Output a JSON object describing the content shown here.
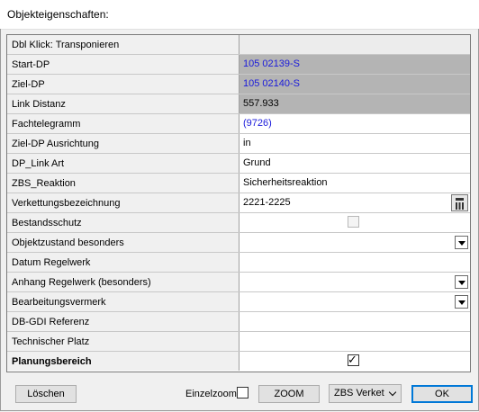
{
  "window": {
    "title": "Objekteigenschaften:"
  },
  "rows": [
    {
      "label": "Dbl Klick: Transponieren",
      "value": ""
    },
    {
      "label": "Start-DP",
      "value": "105 02139-S"
    },
    {
      "label": "Ziel-DP",
      "value": "105 02140-S"
    },
    {
      "label": "Link Distanz",
      "value": "557.933"
    },
    {
      "label": "Fachtelegramm",
      "value": "(9726)"
    },
    {
      "label": "Ziel-DP Ausrichtung",
      "value": "in"
    },
    {
      "label": "DP_Link Art",
      "value": "Grund"
    },
    {
      "label": "ZBS_Reaktion",
      "value": "Sicherheitsreaktion"
    },
    {
      "label": "Verkettungsbezeichnung",
      "value": "2221-2225"
    },
    {
      "label": "Bestandsschutz",
      "value": ""
    },
    {
      "label": "Objektzustand besonders",
      "value": ""
    },
    {
      "label": "Datum Regelwerk",
      "value": ""
    },
    {
      "label": "Anhang Regelwerk (besonders)",
      "value": ""
    },
    {
      "label": "Bearbeitungsvermerk",
      "value": ""
    },
    {
      "label": "DB-GDI Referenz",
      "value": ""
    },
    {
      "label": "Technischer Platz",
      "value": ""
    },
    {
      "label": "Planungsbereich",
      "value": ""
    }
  ],
  "checks": {
    "bestandsschutz": false,
    "planungsbereich": true,
    "mark": "✓"
  },
  "footer": {
    "loeschen": "Löschen",
    "einzelzoom": "Einzelzoom",
    "einzelzoom_checked": false,
    "zoom": "ZOOM",
    "combo_value": "ZBS Verket",
    "ok": "OK"
  },
  "colors": {
    "grey_cell": "#b4b4b4",
    "link_blue": "#1a1adb",
    "focus_blue": "#0078d7"
  },
  "icons": [
    "calculator-icon",
    "dropdown-arrow-icon",
    "chevron-down-icon",
    "checkbox-checkmark-icon"
  ]
}
